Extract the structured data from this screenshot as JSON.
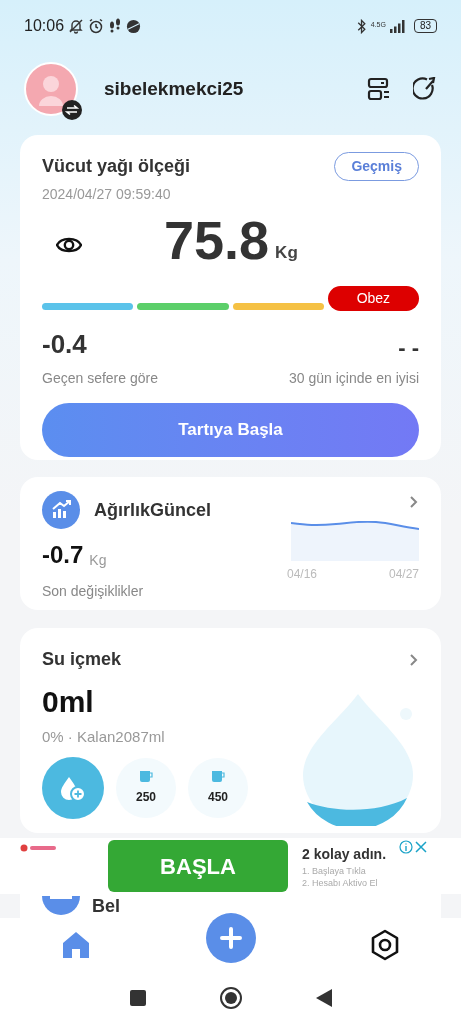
{
  "status_bar": {
    "time": "10:06",
    "network": "4.5G",
    "battery": "83"
  },
  "profile": {
    "username": "sibelekmekci25"
  },
  "body_fat_card": {
    "title": "Vücut yağı ölçeği",
    "history_button": "Geçmiş",
    "timestamp": "2024/04/27 09:59:40",
    "weight": "75.8",
    "unit": "Kg",
    "scale": [
      {
        "color": "#5bc3ea",
        "selected": false
      },
      {
        "color": "#5ccf6a",
        "selected": false
      },
      {
        "color": "#f5c144",
        "selected": false
      },
      {
        "color": "#dd0000",
        "selected": true,
        "label": "Obez"
      }
    ],
    "change_value": "-0.4",
    "change_label": "Geçen sefere göre",
    "best_value": "- -",
    "best_label": "30 gün içinde en iyisi",
    "start_button": "Tartıya Başla"
  },
  "weight_card": {
    "title": "AğırlıkGüncel",
    "value": "-0.7",
    "unit": "Kg",
    "caption": "Son değişiklikler",
    "x_labels": [
      "04/16",
      "04/27"
    ]
  },
  "water_card": {
    "title": "Su içmek",
    "amount": "0ml",
    "summary": "0% · Kalan2087ml",
    "cups": [
      "250",
      "450"
    ]
  },
  "partial_card": {
    "title": "Bel"
  },
  "ad": {
    "button": "BAŞLA",
    "headline": "2 kolay adın.",
    "steps": [
      "1. Başlaya Tıkla",
      "2. Hesabı Aktivo El"
    ]
  },
  "bottom_nav": [
    {
      "kind": "home",
      "selected": true
    },
    {
      "kind": "add",
      "selected": false
    },
    {
      "kind": "settings",
      "selected": false
    }
  ]
}
